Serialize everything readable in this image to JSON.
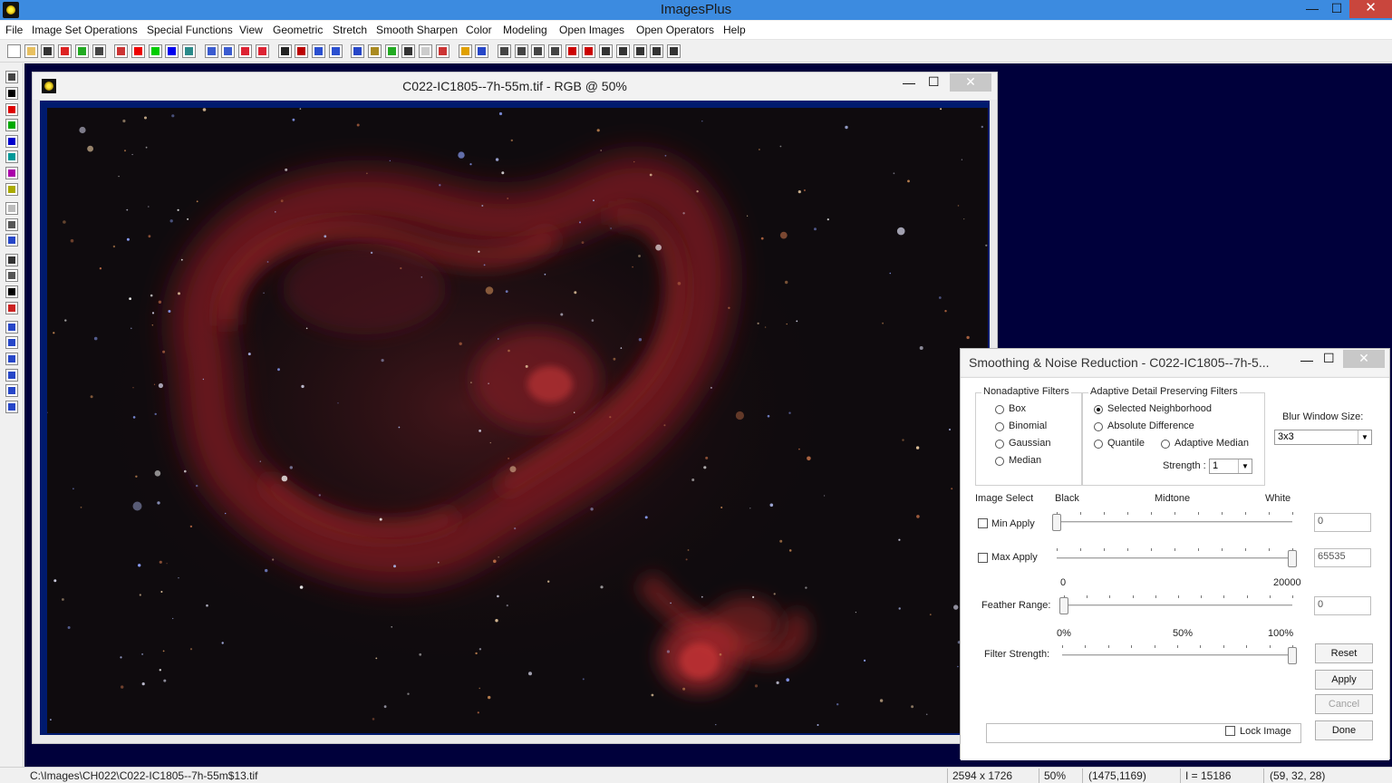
{
  "app": {
    "title": "ImagesPlus"
  },
  "window_controls": {
    "minimize": "—",
    "maximize": "☐",
    "close": "✕"
  },
  "menu": [
    "File",
    "Image Set Operations",
    "Special Functions",
    "View",
    "Geometric",
    "Stretch",
    "Smooth Sharpen",
    "Color",
    "Modeling",
    "Open Images",
    "Open Operators",
    "Help"
  ],
  "toolbar_icons": [
    "new-icon",
    "open-icon",
    "save-icon",
    "delete-red-icon",
    "delete-green-icon",
    "print-icon",
    "rgb-channels-icon",
    "red-channel-icon",
    "green-channel-icon",
    "blue-channel-icon",
    "grid-icon",
    "undo-icon",
    "redo-icon",
    "undo-all-icon",
    "redo-all-icon",
    "star-mask-icon",
    "red-mask-icon",
    "dotted-line-icon",
    "crop-icon",
    "triangle-icon",
    "measure-icon",
    "plus-icon",
    "crosshair-icon",
    "small-box-icon",
    "palette-icon",
    "pencil-icon",
    "table-icon",
    "zoom-in-icon",
    "zoom-out-icon",
    "zoom-fit-icon",
    "zoom-actual-icon",
    "add-window-icon",
    "remove-window-icon",
    "square-1-icon",
    "square-2-icon",
    "square-3-icon",
    "square-4-icon",
    "square-5-icon"
  ],
  "image_window": {
    "title": "C022-IC1805--7h-55m.tif - RGB @ 50%"
  },
  "dialog": {
    "title": "Smoothing & Noise Reduction - C022-IC1805--7h-5...",
    "nonadaptive": {
      "title": "Nonadaptive Filters",
      "options": [
        "Box",
        "Binomial",
        "Gaussian",
        "Median"
      ]
    },
    "adaptive": {
      "title": "Adaptive Detail Preserving Filters",
      "option_selected": "Selected Neighborhood",
      "option_abs": "Absolute Difference",
      "option_quantile": "Quantile",
      "option_median": "Adaptive Median",
      "strength_label": "Strength :",
      "strength_value": "1"
    },
    "blur": {
      "label": "Blur Window Size:",
      "value": "3x3"
    },
    "image_select": {
      "label": "Image Select",
      "black": "Black",
      "midtone": "Midtone",
      "white": "White",
      "min_label": "Min Apply",
      "min_value": "0",
      "max_label": "Max Apply",
      "max_value": "65535",
      "min_level": 0,
      "max_level": 1
    },
    "feather": {
      "label": "Feather Range:",
      "min": "0",
      "max": "20000",
      "value": "0",
      "level": 0
    },
    "strength": {
      "label": "Filter Strength:",
      "p0": "0%",
      "p50": "50%",
      "p100": "100%",
      "level": 1
    },
    "buttons": {
      "reset": "Reset",
      "apply": "Apply",
      "cancel": "Cancel",
      "done": "Done"
    },
    "lock_image": "Lock Image"
  },
  "status": {
    "path": "C:\\Images\\CH022\\C022-IC1805--7h-55m$13.tif",
    "dimensions": "2594 x 1726",
    "zoom": "50%",
    "cursor": "(1475,1169)",
    "intensity": "I = 15186",
    "rgb": "(59, 32, 28)"
  }
}
